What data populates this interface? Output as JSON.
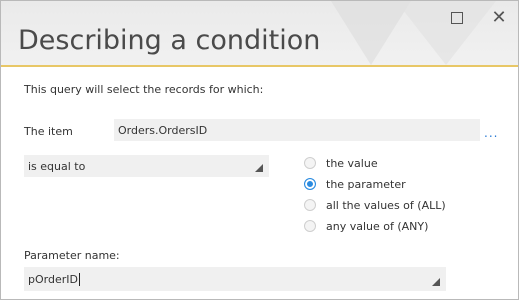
{
  "window": {
    "title": "Describing a condition",
    "maximize_icon": "maximize-icon",
    "close_icon": "close-icon",
    "close_glyph": "✕"
  },
  "query": {
    "description": "This query will select the records for which:"
  },
  "item": {
    "label": "The item",
    "value": "Orders.OrdersID",
    "browse_label": "..."
  },
  "operator": {
    "selected": "is equal to"
  },
  "compare_with": {
    "options": [
      {
        "label": "the value",
        "checked": false
      },
      {
        "label": "the parameter",
        "checked": true
      },
      {
        "label": "all the values of (ALL)",
        "checked": false
      },
      {
        "label": "any value of (ANY)",
        "checked": false
      }
    ]
  },
  "parameter": {
    "label": "Parameter name:",
    "value": "pOrderID"
  },
  "colors": {
    "accent_line": "#e8c766",
    "radio_checked": "#2a8be0",
    "browse_link": "#2a7bd4"
  }
}
